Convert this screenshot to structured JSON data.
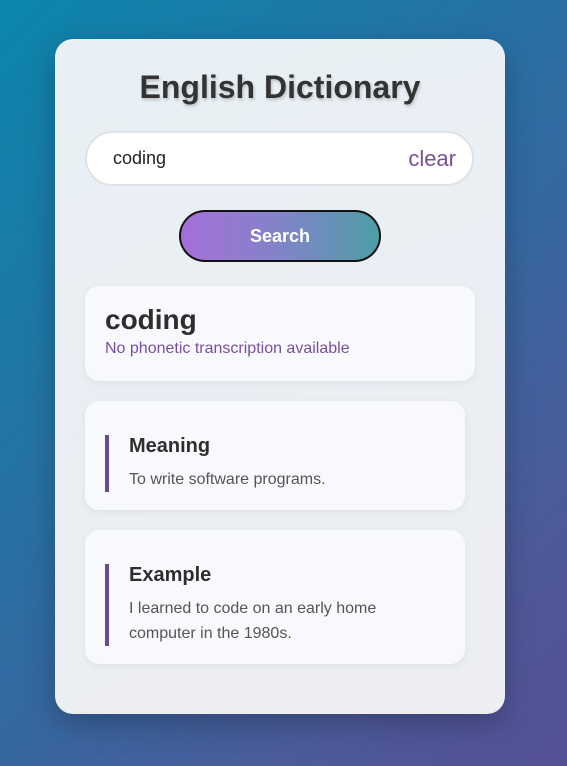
{
  "app": {
    "title": "English Dictionary"
  },
  "search": {
    "value": "coding",
    "placeholder": "",
    "clear_label": "clear",
    "button_label": "Search"
  },
  "result": {
    "word": "coding",
    "phonetic": "No phonetic transcription available",
    "meaning_heading": "Meaning",
    "meaning_text": "To write software programs.",
    "example_heading": "Example",
    "example_text": "I learned to code on an early home computer in the 1980s."
  },
  "colors": {
    "accent": "#7a4f9a",
    "border_accent": "#6a4a8e"
  }
}
